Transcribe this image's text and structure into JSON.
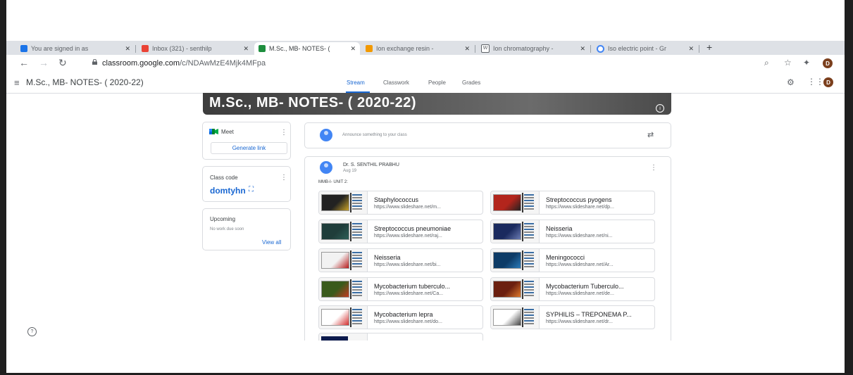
{
  "tabs": [
    {
      "title": "You are signed in as",
      "color": "#1a73e8"
    },
    {
      "title": "Inbox (321) - senthilp",
      "color": "#ea4335"
    },
    {
      "title": "M.Sc., MB- NOTES- (",
      "color": "#1e8e3e"
    },
    {
      "title": "Ion exchange resin -",
      "color": "#f29900"
    },
    {
      "title": "Ion chromatography -",
      "color": "#5f6368"
    },
    {
      "title": "Iso electric point - Gr",
      "color": "#4285f4"
    }
  ],
  "browser": {
    "url_domain": "classroom.google.com",
    "url_path": "/c/NDAwMzE4Mjk4MFpa",
    "avatar_letter": "D"
  },
  "classroom": {
    "title": "M.Sc., MB- NOTES- ( 2020-22)",
    "nav": [
      "Stream",
      "Classwork",
      "People",
      "Grades"
    ],
    "banner_title": "M.Sc., MB- NOTES- ( 2020-22)"
  },
  "meet": {
    "label": "Meet",
    "button": "Generate link"
  },
  "class_code": {
    "label": "Class code",
    "code": "domtyhn"
  },
  "upcoming": {
    "label": "Upcoming",
    "empty": "No work due soon",
    "view_all": "View all"
  },
  "announce": {
    "placeholder": "Announce something to your class"
  },
  "post": {
    "author": "Dr. S. SENTHIL PRABHU",
    "date": "Aug 19",
    "text": "MMB-I- UNIT 2:",
    "attachments": [
      {
        "title": "Staphylococcus",
        "url": "https://www.slideshare.net/m...",
        "c1": "#222222",
        "c2": "#c9a227"
      },
      {
        "title": "Streptococcus pyogens",
        "url": "https://www.slideshare.net/dp...",
        "c1": "#b3251c",
        "c2": "#222222"
      },
      {
        "title": "Streptococcus pneumoniae",
        "url": "https://www.slideshare.net/raj...",
        "c1": "#1f3d3a",
        "c2": "#2e5f57"
      },
      {
        "title": "Neisseria",
        "url": "https://www.slideshare.net/ni...",
        "c1": "#1a2a5e",
        "c2": "#6a7bb3"
      },
      {
        "title": "Neisseria",
        "url": "https://www.slideshare.net/bi...",
        "c1": "#f2f2f2",
        "c2": "#b71c1c"
      },
      {
        "title": "Meningococci",
        "url": "https://www.slideshare.net/Ar...",
        "c1": "#0d3b66",
        "c2": "#2b7bb9"
      },
      {
        "title": "Mycobacterium tuberculo...",
        "url": "https://www.slideshare.net/Ca...",
        "c1": "#3a5a1c",
        "c2": "#c23b22"
      },
      {
        "title": "Mycobacterium Tuberculo...",
        "url": "https://www.slideshare.net/de...",
        "c1": "#6b1f0f",
        "c2": "#e07a2b"
      },
      {
        "title": "Mycobacterium lepra",
        "url": "https://www.slideshare.net/do...",
        "c1": "#ffffff",
        "c2": "#d32f2f"
      },
      {
        "title": "SYPHILIS – TREPONEMA P...",
        "url": "https://www.slideshare.net/dr...",
        "c1": "#ffffff",
        "c2": "#444444"
      }
    ],
    "partial_color": "#0d1b4d"
  },
  "colors": {
    "accent": "#1967d2",
    "banner": "#4a4a4a"
  }
}
